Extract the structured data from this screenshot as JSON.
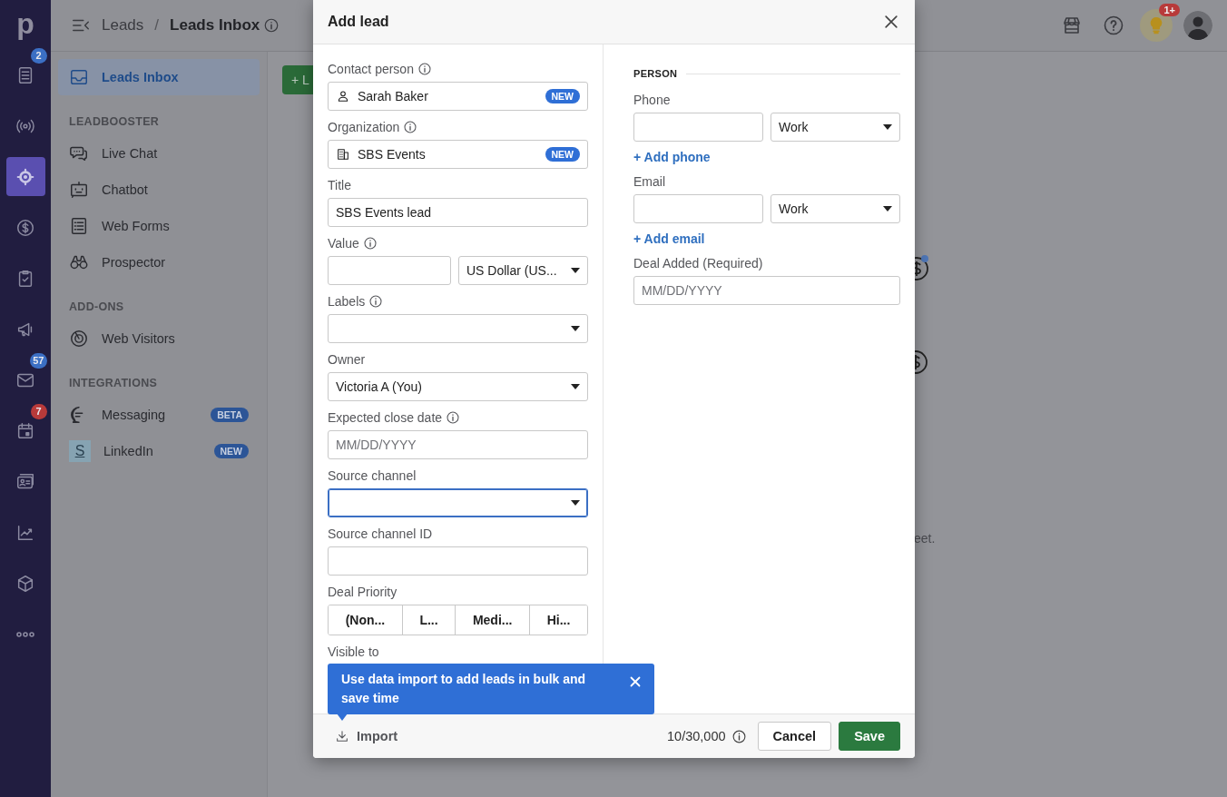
{
  "rail": {
    "logo": "p",
    "items": [
      {
        "selected": false,
        "badge": "2",
        "color": "#3b6fc4"
      },
      {
        "selected": false
      },
      {
        "selected": true
      },
      {
        "selected": false
      },
      {
        "selected": false
      },
      {
        "selected": false
      },
      {
        "selected": false,
        "badge": "57",
        "color": "#3b6fc4"
      },
      {
        "selected": false,
        "badge": "7",
        "color": "#b83a3a"
      },
      {
        "selected": false
      },
      {
        "selected": false
      },
      {
        "selected": false
      },
      {
        "selected": false
      }
    ]
  },
  "topbar": {
    "breadcrumb": [
      "Leads",
      "Leads Inbox"
    ],
    "separator": "/",
    "tips_badge": "1+"
  },
  "sidebar": {
    "items": [
      {
        "label": "Leads Inbox",
        "selected": true
      }
    ],
    "sections": [
      {
        "heading": "LEADBOOSTER",
        "items": [
          {
            "label": "Live Chat",
            "selected": false
          },
          {
            "label": "Chatbot",
            "selected": false
          },
          {
            "label": "Web Forms",
            "selected": false
          },
          {
            "label": "Prospector",
            "selected": false
          }
        ]
      },
      {
        "heading": "ADD-ONS",
        "items": [
          {
            "label": "Web Visitors",
            "selected": false
          }
        ]
      },
      {
        "heading": "INTEGRATIONS",
        "items": [
          {
            "label": "Messaging",
            "tag": "BETA",
            "selected": false
          },
          {
            "label": "LinkedIn",
            "tag": "NEW",
            "logo": "S",
            "selected": false
          }
        ]
      }
    ]
  },
  "main": {
    "add_button": "+ L",
    "fragment_text": "eet."
  },
  "modal": {
    "title": "Add lead",
    "left_fields": [
      {
        "kind": "entity",
        "label": "Contact person",
        "info": true,
        "value": "Sarah Baker",
        "tag": "NEW"
      },
      {
        "kind": "entity",
        "label": "Organization",
        "info": true,
        "value": "SBS Events",
        "tag": "NEW"
      },
      {
        "kind": "text",
        "label": "Title",
        "value": "SBS Events lead"
      },
      {
        "kind": "split",
        "label": "Value",
        "info": true,
        "option": "US Dollar (US..."
      },
      {
        "kind": "select",
        "label": "Labels",
        "info": true,
        "focused": false
      },
      {
        "kind": "select",
        "label": "Owner",
        "value": "Victoria A (You)",
        "focused": false
      },
      {
        "kind": "text",
        "label": "Expected close date",
        "info": true,
        "placeholder": "MM/DD/YYYY"
      },
      {
        "kind": "select",
        "label": "Source channel",
        "focused": true
      },
      {
        "kind": "text",
        "label": "Source channel ID"
      },
      {
        "kind": "segmented",
        "label": "Deal Priority",
        "options": [
          {
            "label": "(Non...",
            "selected": false
          },
          {
            "label": "L...",
            "selected": false
          },
          {
            "label": "Medi...",
            "selected": false
          },
          {
            "label": "Hi...",
            "selected": false
          }
        ]
      },
      {
        "kind": "label",
        "label": "Visible to"
      }
    ],
    "right_section": "PERSON",
    "right_fields": [
      {
        "kind": "split",
        "label": "Phone",
        "option": "Work"
      },
      {
        "kind": "link",
        "label": "+ Add phone"
      },
      {
        "kind": "split",
        "label": "Email",
        "option": "Work"
      },
      {
        "kind": "link",
        "label": "+ Add email"
      },
      {
        "kind": "text",
        "label": "Deal Added (Required)",
        "placeholder": "MM/DD/YYYY"
      }
    ],
    "tooltip": "Use data import to add leads in bulk and save time",
    "footer": {
      "import": "Import",
      "counter": "10/30,000",
      "cancel": "Cancel",
      "save": "Save"
    }
  }
}
